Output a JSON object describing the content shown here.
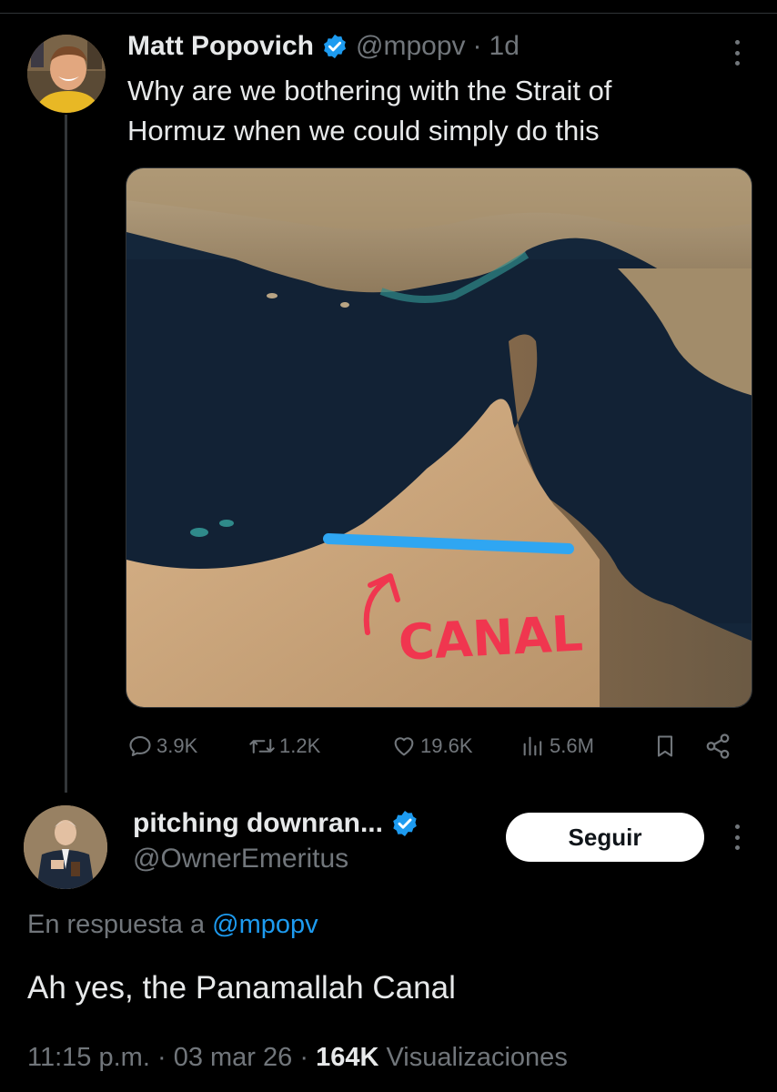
{
  "tweet": {
    "author_name": "Matt Popovich",
    "handle": "@mpopv",
    "separator": "·",
    "time_ago": "1d",
    "text_line1": "Why are we bothering with the Strait of",
    "text_line2": "Hormuz when we could simply do this",
    "media": {
      "annotation_text": "CANAL",
      "colors": {
        "canal_line": "#2fa6f2",
        "annotation": "#f0364f",
        "water": "#14263a",
        "land": "#c9a57a"
      }
    },
    "actions": {
      "replies": "3.9K",
      "retweets": "1.2K",
      "likes": "19.6K",
      "views": "5.6M"
    }
  },
  "reply": {
    "author_name": "pitching downran...",
    "handle": "@OwnerEmeritus",
    "follow_label": "Seguir",
    "reply_prefix": "En respuesta a",
    "reply_mention": "@mpopv",
    "text": "Ah yes, the Panamallah Canal",
    "time": "11:15 p.m.",
    "date": "03 mar 26",
    "separator": "·",
    "views_count": "164K",
    "views_label": "Visualizaciones"
  },
  "colors": {
    "background": "#000000",
    "text_primary": "#e7e9ea",
    "text_secondary": "#71767b",
    "accent": "#1d9bf0",
    "verified_badge": "#1d9bf0"
  }
}
